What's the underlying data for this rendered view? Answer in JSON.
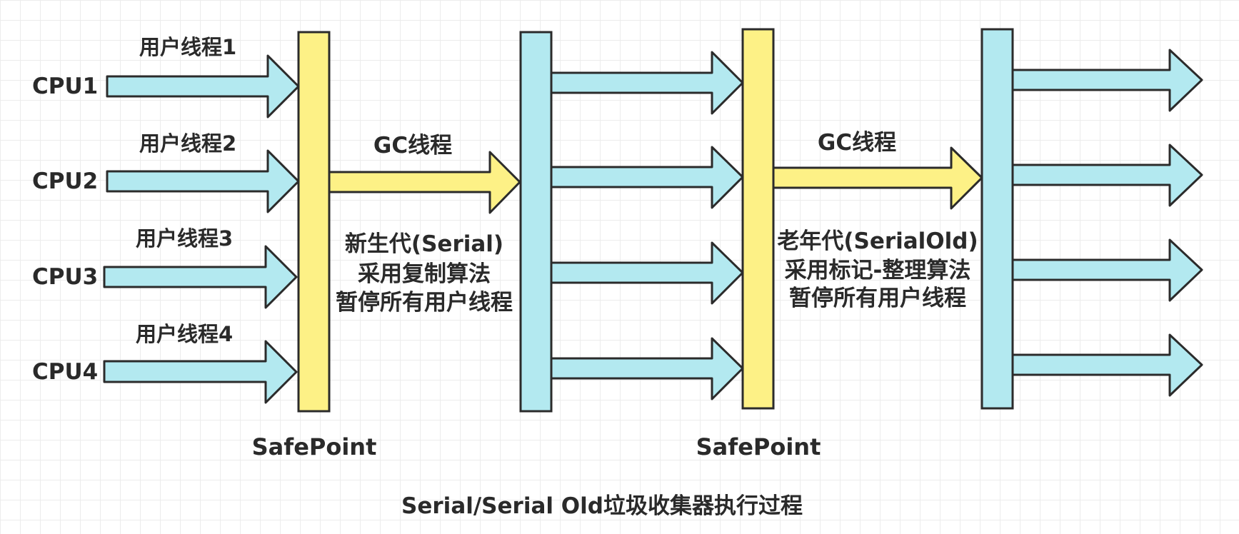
{
  "colors": {
    "cyan_fill": "#b3e9f0",
    "yellow_fill": "#fdf186",
    "stroke": "#2b2b2b",
    "text": "#2a2a2a",
    "grid": "#ececec"
  },
  "cpus": [
    "CPU1",
    "CPU2",
    "CPU3",
    "CPU4"
  ],
  "user_threads": [
    "用户线程1",
    "用户线程2",
    "用户线程3",
    "用户线程4"
  ],
  "safepoints": [
    "SafePoint",
    "SafePoint"
  ],
  "gc_threads": [
    "GC线程",
    "GC线程"
  ],
  "young_gen": {
    "lines": [
      "新生代(Serial)",
      "采用复制算法",
      "暂停所有用户线程"
    ]
  },
  "old_gen": {
    "lines": [
      "老年代(SerialOld)",
      "采用标记-整理算法",
      "暂停所有用户线程"
    ]
  },
  "caption": "Serial/Serial Old垃圾收集器执行过程"
}
